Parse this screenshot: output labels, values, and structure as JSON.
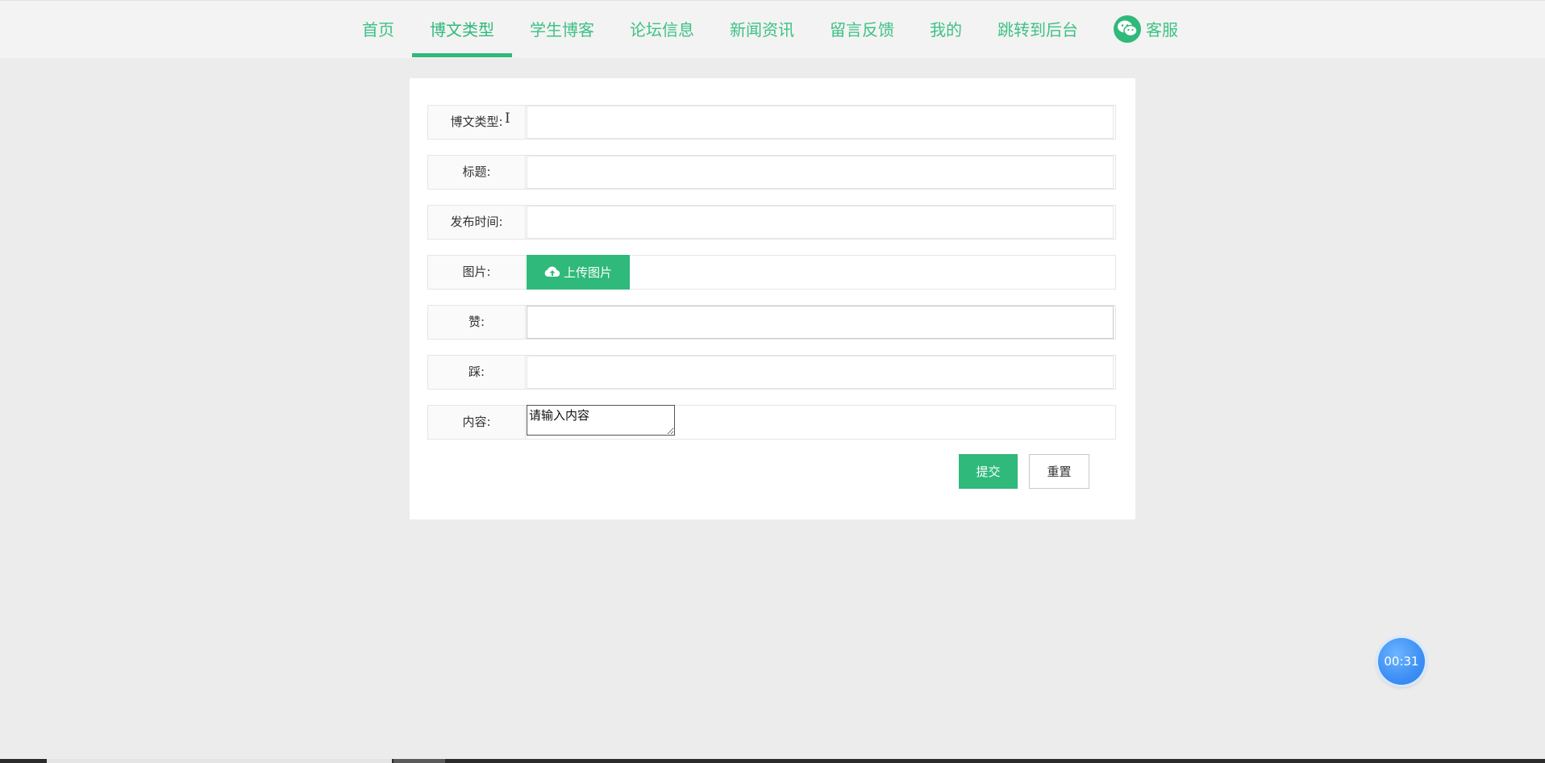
{
  "nav": {
    "items": [
      {
        "label": "首页",
        "active": false
      },
      {
        "label": "博文类型",
        "active": true
      },
      {
        "label": "学生博客",
        "active": false
      },
      {
        "label": "论坛信息",
        "active": false
      },
      {
        "label": "新闻资讯",
        "active": false
      },
      {
        "label": "留言反馈",
        "active": false
      },
      {
        "label": "我的",
        "active": false
      },
      {
        "label": "跳转到后台",
        "active": false
      }
    ],
    "service": {
      "label": "客服",
      "icon": "wechat-icon"
    },
    "accent_color": "#2fb97a"
  },
  "form": {
    "fields": {
      "type": {
        "label": "博文类型:",
        "value": ""
      },
      "title": {
        "label": "标题:",
        "value": ""
      },
      "publish_time": {
        "label": "发布时间:",
        "value": ""
      },
      "image": {
        "label": "图片:",
        "button_label": "上传图片",
        "icon": "cloud-upload-icon"
      },
      "likes": {
        "label": "赞:",
        "value": ""
      },
      "dislikes": {
        "label": "踩:",
        "value": ""
      },
      "content": {
        "label": "内容:",
        "placeholder": "请输入内容"
      }
    },
    "submit_label": "提交",
    "reset_label": "重置"
  },
  "timer": {
    "label": "00:31"
  }
}
